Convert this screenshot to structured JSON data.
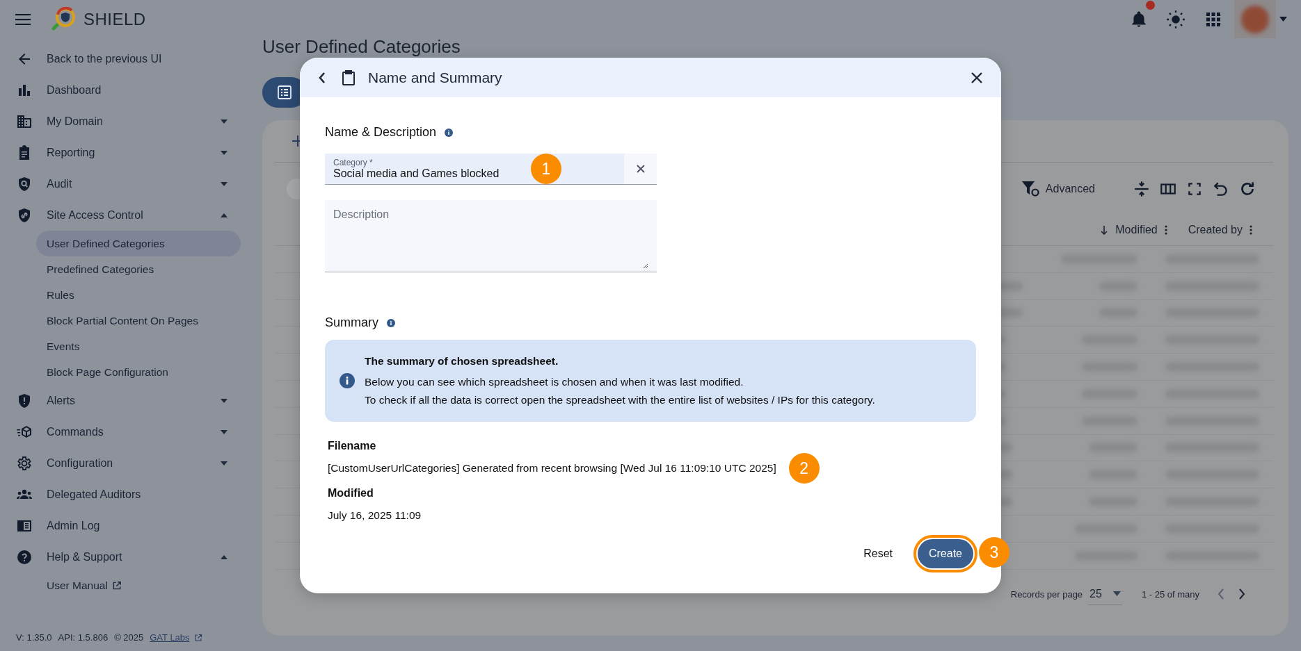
{
  "app": {
    "title": "SHIELD",
    "notifications": {
      "unread": true
    }
  },
  "sidebar": {
    "items": [
      {
        "kind": "back",
        "label": "Back to the previous UI"
      },
      {
        "kind": "item",
        "label": "Dashboard"
      },
      {
        "kind": "item",
        "label": "My Domain",
        "expanded": false
      },
      {
        "kind": "item",
        "label": "Reporting",
        "expanded": false
      },
      {
        "kind": "item",
        "label": "Audit",
        "expanded": false
      },
      {
        "kind": "item",
        "label": "Site Access Control",
        "expanded": true,
        "children": [
          {
            "label": "User Defined Categories",
            "selected": true
          },
          {
            "label": "Predefined Categories",
            "selected": false
          },
          {
            "label": "Rules",
            "selected": false
          },
          {
            "label": "Block Partial Content On Pages",
            "selected": false
          },
          {
            "label": "Events",
            "selected": false
          },
          {
            "label": "Block Page Configuration",
            "selected": false
          }
        ]
      },
      {
        "kind": "item",
        "label": "Alerts",
        "expanded": false
      },
      {
        "kind": "item",
        "label": "Commands",
        "expanded": false
      },
      {
        "kind": "item",
        "label": "Configuration",
        "expanded": false
      },
      {
        "kind": "item",
        "label": "Delegated Auditors"
      },
      {
        "kind": "item",
        "label": "Admin Log"
      },
      {
        "kind": "item",
        "label": "Help & Support",
        "expanded": true,
        "children": [
          {
            "label": "User Manual",
            "selected": false,
            "external": true
          }
        ]
      }
    ],
    "footer": {
      "version": "V: 1.35.0",
      "api": "API: 1.5.806",
      "copyright": "© 2025",
      "link": "GAT Labs"
    }
  },
  "page": {
    "title": "User Defined Categories",
    "toolbar": {
      "advanced": "Advanced"
    },
    "columns": [
      {
        "label": "Modified",
        "sorted": true
      },
      {
        "label": "Created by",
        "sorted": false
      }
    ],
    "pagination": {
      "label": "Records per page",
      "value": "25",
      "range": "1 - 25 of many"
    }
  },
  "modal": {
    "title": "Name and Summary",
    "name_section": {
      "heading": "Name & Description",
      "category": {
        "label": "Category *",
        "value": "Social media and Games blocked",
        "callout": "1"
      },
      "description": {
        "placeholder": "Description"
      }
    },
    "summary_section": {
      "heading": "Summary",
      "info": {
        "title": "The summary of chosen spreadsheet.",
        "lines": [
          "Below you can see which spreadsheet is chosen and when it was last modified.",
          "To check if all the data is correct open the spreadsheet with the entire list of websites / IPs for this category."
        ]
      },
      "details": [
        {
          "label": "Filename",
          "value": "[CustomUserUrlCategories] Generated from recent browsing [Wed Jul 16 11:09:10 UTC 2025]",
          "callout": "2"
        },
        {
          "label": "Modified",
          "value": "July 16, 2025 11:09"
        }
      ]
    },
    "buttons": [
      {
        "kind": "text",
        "label": "Reset",
        "highlighted": false
      },
      {
        "kind": "primary",
        "label": "Create",
        "highlighted": true,
        "callout": "3"
      }
    ]
  }
}
